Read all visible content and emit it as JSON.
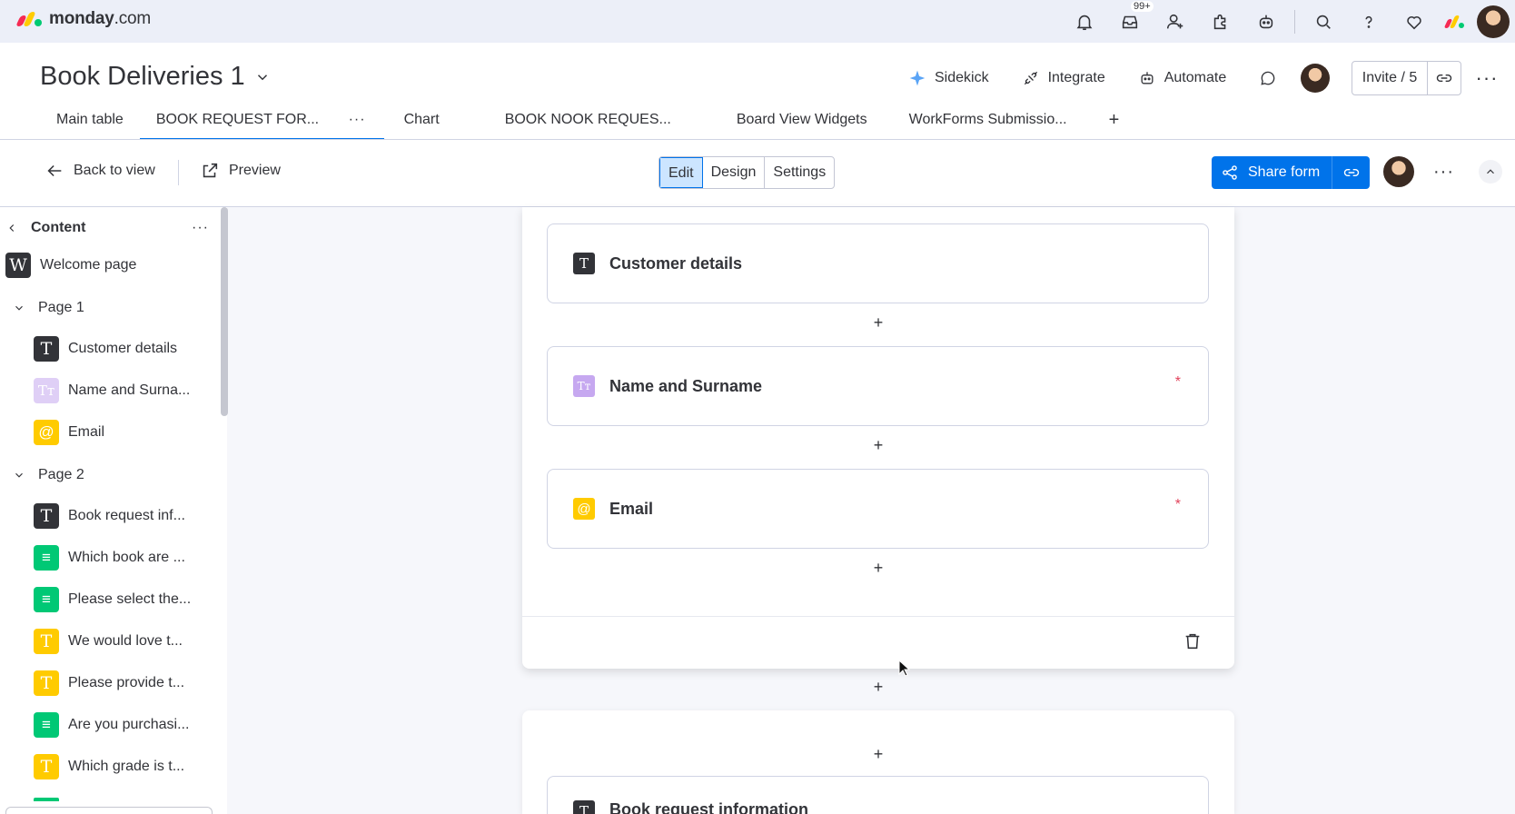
{
  "app": {
    "brand_bold": "monday",
    "brand_light": ".com",
    "notification_badge": "99+"
  },
  "board": {
    "title": "Book Deliveries 1",
    "actions": {
      "sidekick": "Sidekick",
      "integrate": "Integrate",
      "automate": "Automate",
      "invite": "Invite / 5"
    },
    "tabs": [
      {
        "label": "Main table"
      },
      {
        "label": "BOOK REQUEST FOR..."
      },
      {
        "label": "Chart"
      },
      {
        "label": "BOOK NOOK REQUES..."
      },
      {
        "label": "Board View Widgets"
      },
      {
        "label": "WorkForms Submissio..."
      }
    ],
    "tab_more": "···",
    "tab_add": "+"
  },
  "form_toolbar": {
    "back": "Back to view",
    "preview": "Preview",
    "edit": "Edit",
    "design": "Design",
    "settings": "Settings",
    "share": "Share form",
    "more": "···"
  },
  "sidebar": {
    "title": "Content",
    "more": "···",
    "welcome": {
      "icon": "W",
      "label": "Welcome page"
    },
    "page1": {
      "label": "Page 1",
      "items": [
        {
          "icon": "T",
          "label": "Customer details"
        },
        {
          "icon": "Tт",
          "label": "Name and Surna..."
        },
        {
          "icon": "@",
          "label": "Email"
        }
      ]
    },
    "page2": {
      "label": "Page 2",
      "items": [
        {
          "icon": "T",
          "label": "Book request inf..."
        },
        {
          "icon": "≡",
          "label": "Which book are ..."
        },
        {
          "icon": "≡",
          "label": "Please select the..."
        },
        {
          "icon": "T",
          "label": "We would love t..."
        },
        {
          "icon": "T",
          "label": "Please provide t..."
        },
        {
          "icon": "≡",
          "label": "Are you purchasi..."
        },
        {
          "icon": "T",
          "label": "Which grade is t..."
        }
      ]
    }
  },
  "canvas": {
    "questions": [
      {
        "icon": "T",
        "title": "Customer details",
        "required": ""
      },
      {
        "icon": "Tт",
        "title": "Name and Surname",
        "required": "*"
      },
      {
        "icon": "@",
        "title": "Email",
        "required": "*"
      }
    ],
    "add": "+",
    "next_page_question": {
      "icon": "T",
      "title": "Book request information"
    }
  },
  "colors": {
    "accent": "#0073ea",
    "required": "#e2445c",
    "yellow_icon": "#ffcb00",
    "green_icon": "#00c875",
    "purple_icon": "#c6a8f0"
  }
}
